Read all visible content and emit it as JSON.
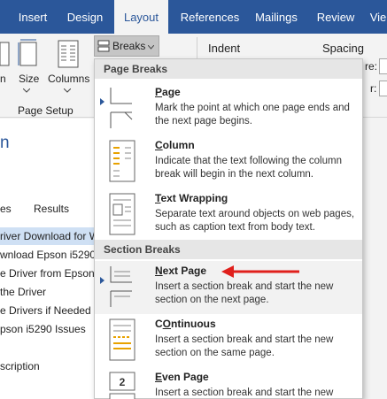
{
  "tabs": [
    {
      "label": "Insert"
    },
    {
      "label": "Design"
    },
    {
      "label": "Layout"
    },
    {
      "label": "References"
    },
    {
      "label": "Mailings"
    },
    {
      "label": "Review"
    },
    {
      "label": "Vie"
    }
  ],
  "ribbon": {
    "breaks_label": "Breaks",
    "indent_label": "Indent",
    "spacing_label": "Spacing",
    "size_label": "Size",
    "columns_label": "Columns",
    "orientation_fragment": "n",
    "group_page_setup": "Page Setup",
    "before_fragment": "re:",
    "after_fragment": "r:"
  },
  "nav": {
    "title_fragment": "n",
    "tab_es": "es",
    "tab_results": "Results",
    "items": [
      "river Download for W",
      "wnload Epson i5290",
      "e Driver from Epson",
      "the Driver",
      "e Drivers if Needed",
      "pson i5290 Issues",
      "scription"
    ]
  },
  "menu": {
    "page_breaks_header": "Page Breaks",
    "section_breaks_header": "Section Breaks",
    "items": [
      {
        "title": "Page",
        "underline": "P",
        "rest": "age",
        "desc": "Mark the point at which one page ends and the next page begins."
      },
      {
        "title": "Column",
        "underline": "C",
        "rest": "olumn",
        "desc": "Indicate that the text following the column break will begin in the next column."
      },
      {
        "title": "Text Wrapping",
        "underline": "T",
        "rest": "ext Wrapping",
        "desc": "Separate text around objects on web pages, such as caption text from body text."
      },
      {
        "title": "Next Page",
        "underline": "N",
        "rest": "ext Page",
        "desc": "Insert a section break and start the new section on the next page."
      },
      {
        "title": "Continuous",
        "underline": "O",
        "rest": "ntinuous",
        "desc": "Insert a section break and start the new section on the same page."
      },
      {
        "title": "Even Page",
        "underline": "E",
        "rest": "ven Page",
        "desc": "Insert a section break and start the new"
      }
    ]
  },
  "colors": {
    "accent": "#2b579a",
    "arrow": "#e0201c"
  }
}
